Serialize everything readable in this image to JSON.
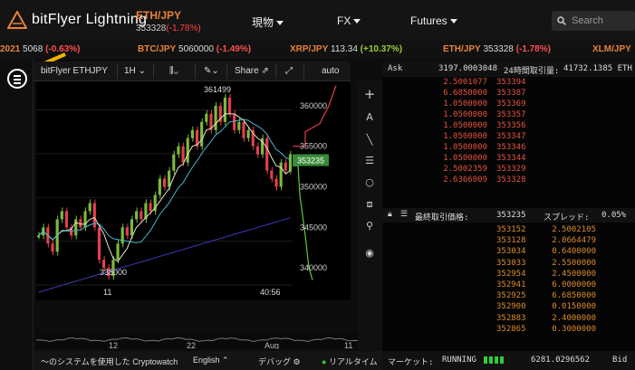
{
  "app": {
    "brand": "bitFlyer Lightning"
  },
  "pair": {
    "name": "ETH/JPY",
    "price": "353328",
    "change": "(-1.78%)"
  },
  "nav": {
    "spot": "現物",
    "fx": "FX",
    "futures": "Futures"
  },
  "search": {
    "placeholder": "Search"
  },
  "ticker": [
    {
      "sym": "2021",
      "px": "5068",
      "chg": "(-0.63%)"
    },
    {
      "sym": "BTC/JPY",
      "px": "5060000",
      "chg": "(-1.49%)"
    },
    {
      "sym": "XRP/JPY",
      "px": "113.34",
      "chg": "(+10.37%)"
    },
    {
      "sym": "ETH/JPY",
      "px": "353328",
      "chg": "(-1.78%)"
    },
    {
      "sym": "XLM/JPY",
      "px": "",
      "chg": ""
    }
  ],
  "chart_toolbar": {
    "symbol": "bitFlyer ETHJPY",
    "interval": "1H",
    "share": "Share",
    "auto": "auto"
  },
  "chart_data": {
    "type": "candlestick",
    "high_label": "361499",
    "low_label": "338000",
    "last_price": "353235",
    "y_ticks": [
      "360000",
      "355000",
      "350000",
      "345000",
      "340000"
    ],
    "x_ticks": [
      "11",
      "40:56"
    ],
    "x_ticks_bottom": [
      "12",
      "22",
      "Aug",
      "11"
    ],
    "ylim": [
      336000,
      363000
    ]
  },
  "orderbook": {
    "ask_label": "Ask",
    "ask_value": "3197.0003048",
    "volume_label": "24時間取引量:",
    "volume_value": "41732.1385 ETH",
    "asks": [
      {
        "sz": "2.5001077",
        "pr": "353394"
      },
      {
        "sz": "6.6850000",
        "pr": "353387"
      },
      {
        "sz": "1.0500000",
        "pr": "353369"
      },
      {
        "sz": "1.0500000",
        "pr": "353357"
      },
      {
        "sz": "1.0500000",
        "pr": "353356"
      },
      {
        "sz": "1.0500000",
        "pr": "353347"
      },
      {
        "sz": "1.0500000",
        "pr": "353346"
      },
      {
        "sz": "1.0500000",
        "pr": "353344"
      },
      {
        "sz": "2.5002359",
        "pr": "353329"
      },
      {
        "sz": "2.6366009",
        "pr": "353328"
      }
    ],
    "mid_label": "最終取引価格:",
    "mid_price": "353235",
    "spread_label": "スプレッド:",
    "spread_value": "0.05%",
    "bids": [
      {
        "pr": "353152",
        "sz": "2.5002105"
      },
      {
        "pr": "353128",
        "sz": "2.0664479"
      },
      {
        "pr": "353034",
        "sz": "0.6400000"
      },
      {
        "pr": "353033",
        "sz": "2.5500000"
      },
      {
        "pr": "352954",
        "sz": "2.4500000"
      },
      {
        "pr": "352941",
        "sz": "6.0000000"
      },
      {
        "pr": "352925",
        "sz": "6.6850000"
      },
      {
        "pr": "352900",
        "sz": "0.0150000"
      },
      {
        "pr": "352883",
        "sz": "2.4000000"
      },
      {
        "pr": "352865",
        "sz": "0.3000000"
      }
    ],
    "market_label": "マーケット:",
    "market_status": "RUNNING",
    "bid_value": "6281.0296562",
    "bid_label": "Bid"
  },
  "footer": {
    "cryptowatch": "〜のシステムを使用した Cryptowatch",
    "language": "English",
    "debug": "デバッグ",
    "realtime": "リアルタイム"
  }
}
